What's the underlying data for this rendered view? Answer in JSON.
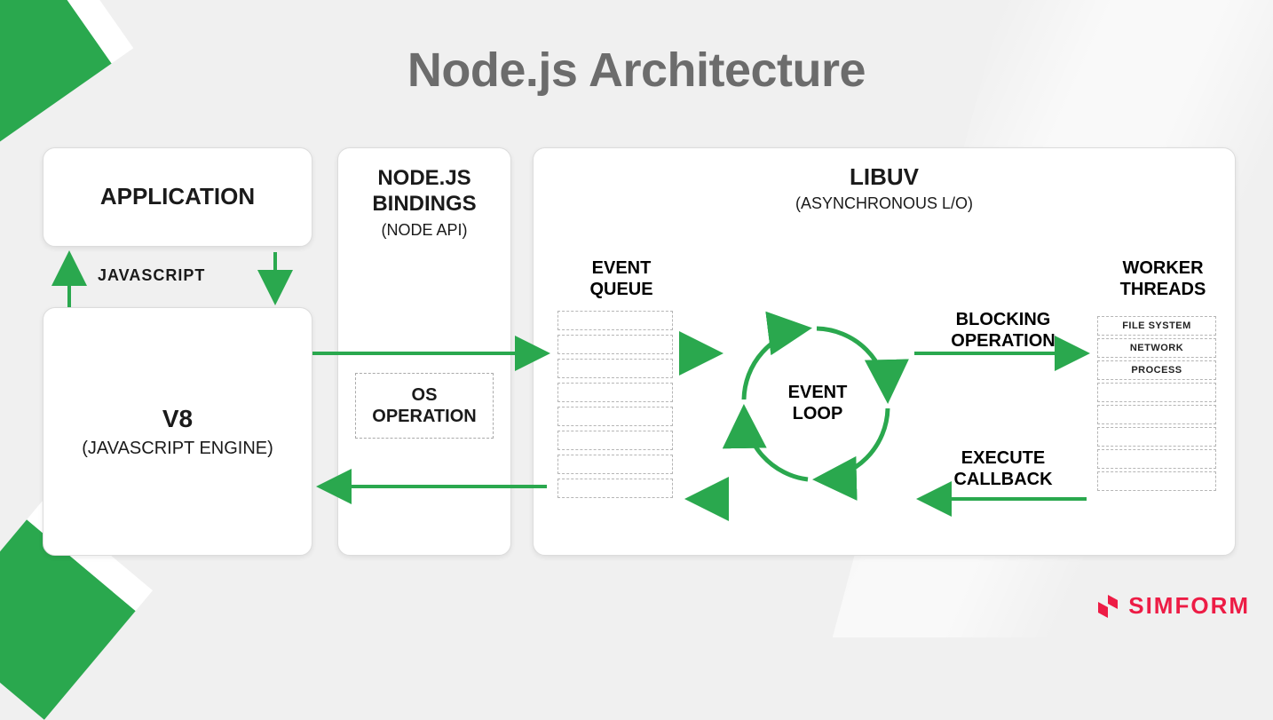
{
  "title": "Node.js Architecture",
  "application": {
    "label": "APPLICATION"
  },
  "js_label": "JAVASCRIPT",
  "v8": {
    "label": "V8",
    "sub": "(JAVASCRIPT ENGINE)"
  },
  "bindings": {
    "label1": "NODE.JS",
    "label2": "BINDINGS",
    "sub": "(NODE API)"
  },
  "os_operation": {
    "label1": "OS",
    "label2": "OPERATION"
  },
  "libuv": {
    "label": "LIBUV",
    "sub": "(ASYNCHRONOUS L/O)"
  },
  "event_queue": {
    "label1": "EVENT",
    "label2": "QUEUE",
    "slots": 8
  },
  "event_loop": {
    "label1": "EVENT",
    "label2": "LOOP"
  },
  "blocking": {
    "label1": "BLOCKING",
    "label2": "OPERATION"
  },
  "exec_callback": {
    "label1": "EXECUTE",
    "label2": "CALLBACK"
  },
  "worker_threads": {
    "label1": "WORKER",
    "label2": "THREADS",
    "items": [
      "FILE SYSTEM",
      "NETWORK",
      "PROCESS",
      "",
      "",
      "",
      "",
      ""
    ]
  },
  "brand": "SIMFORM",
  "colors": {
    "green": "#2aa84e",
    "red": "#ed1c45"
  }
}
